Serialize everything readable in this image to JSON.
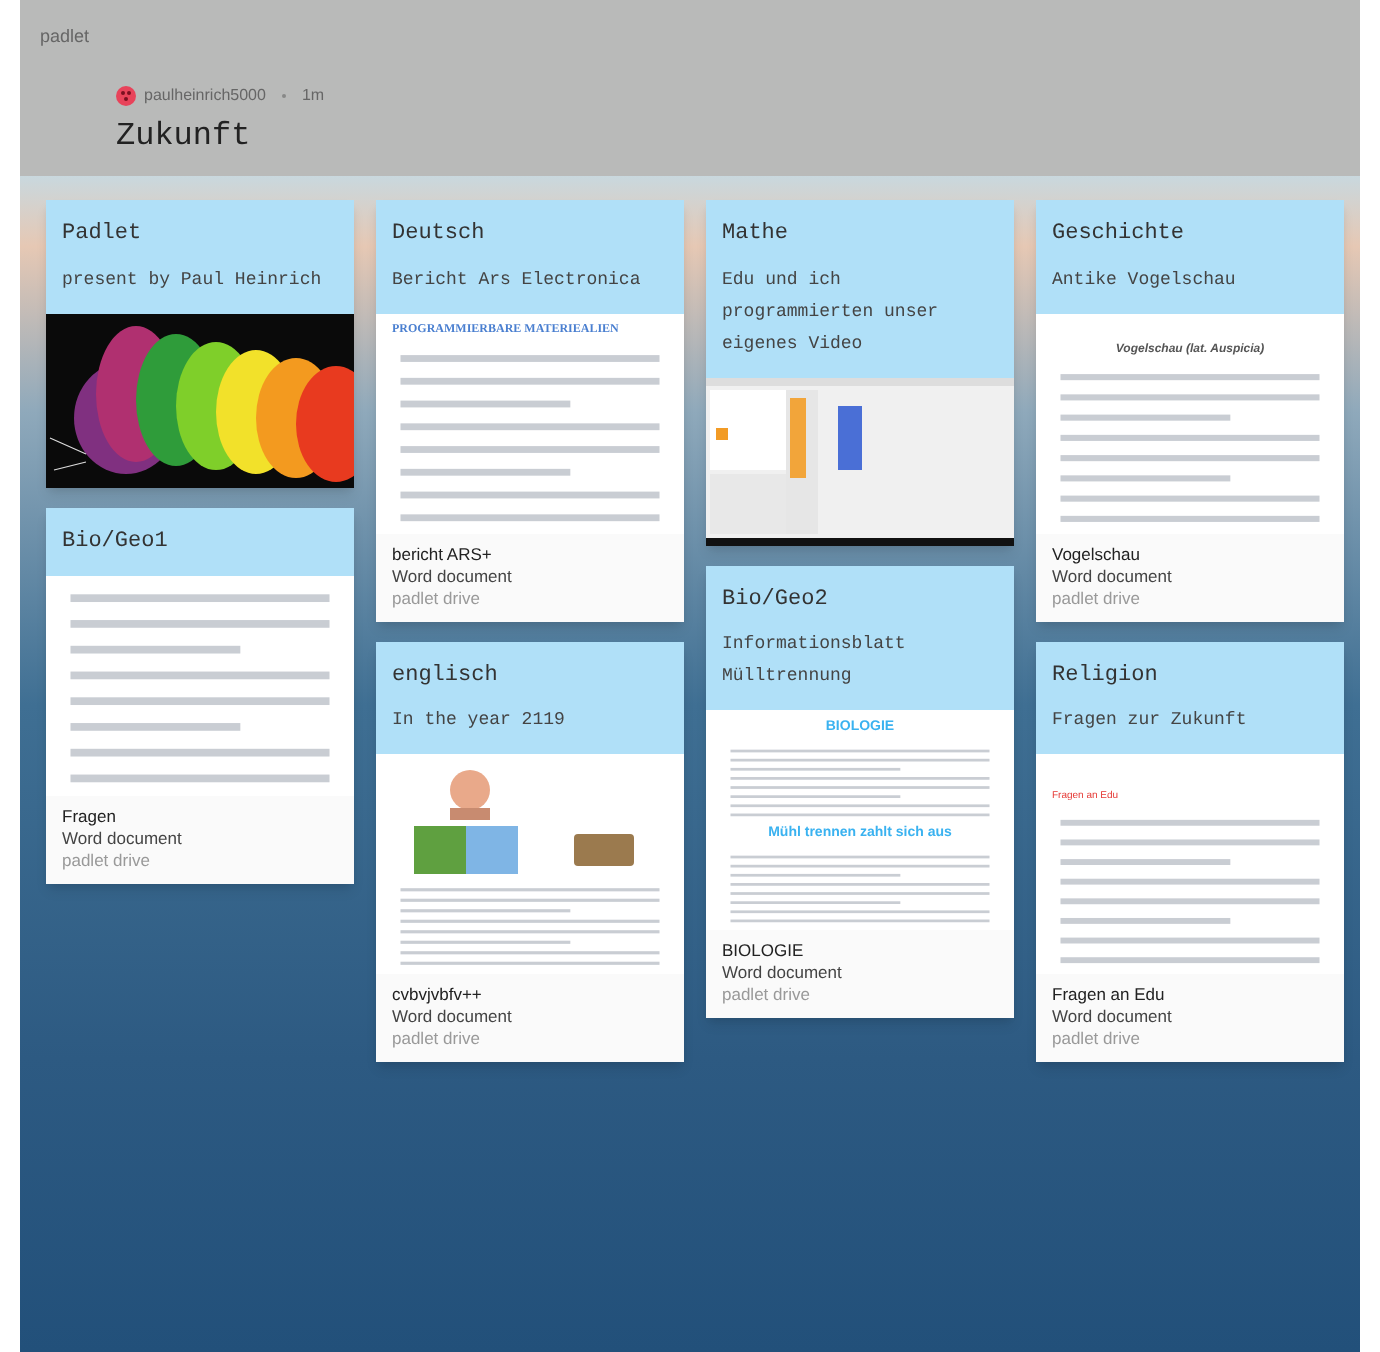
{
  "app_name": "padlet",
  "author": {
    "name": "paulheinrich5000",
    "time": "1m"
  },
  "title": "Zukunft",
  "columns": [
    {
      "posts": [
        {
          "title": "Padlet",
          "subtitle": "present by Paul Heinrich"
        },
        {
          "title": "Bio/Geo1",
          "attachment": {
            "kind": "document",
            "blocks": [
              {
                "kind": "lines"
              }
            ],
            "name": "Fragen",
            "type": "Word document",
            "source": "padlet drive"
          }
        }
      ]
    },
    {
      "posts": [
        {
          "title": "Deutsch",
          "subtitle": "Bericht Ars Electronica",
          "attachment": {
            "kind": "document",
            "blocks": [
              {
                "kind": "serif",
                "text": "PROGRAMMIERBARE MATERIEALIEN"
              },
              {
                "kind": "lines"
              }
            ],
            "name": "bericht ARS+",
            "type": "Word document",
            "source": "padlet drive"
          }
        },
        {
          "title": "englisch",
          "subtitle": "In the year 2119",
          "attachment": {
            "kind": "document",
            "blocks": [
              {
                "kind": "images"
              },
              {
                "kind": "lines"
              }
            ],
            "name": "cvbvjvbfv++",
            "type": "Word document",
            "source": "padlet drive"
          }
        }
      ]
    },
    {
      "posts": [
        {
          "title": "Mathe",
          "subtitle": "Edu und ich programmierten unser eigenes Video",
          "attachment": {
            "kind": "screenshot"
          }
        },
        {
          "title": "Bio/Geo2",
          "subtitle": "Informationsblatt Mülltrennung",
          "attachment": {
            "kind": "document",
            "blocks": [
              {
                "kind": "banner",
                "text": "BIOLOGIE"
              },
              {
                "kind": "lines"
              },
              {
                "kind": "banner",
                "text": "Mühl trennen zahlt sich aus"
              },
              {
                "kind": "lines"
              }
            ],
            "name": "BIOLOGIE",
            "type": "Word document",
            "source": "padlet drive"
          }
        }
      ]
    },
    {
      "posts": [
        {
          "title": "Geschichte",
          "subtitle": "Antike Vogelschau",
          "attachment": {
            "kind": "document",
            "blocks": [
              {
                "kind": "italic",
                "text": "Vogelschau (lat. Auspicia)"
              },
              {
                "kind": "lines"
              }
            ],
            "name": "Vogelschau",
            "type": "Word document",
            "source": "padlet drive"
          }
        },
        {
          "title": "Religion",
          "subtitle": "Fragen zur Zukunft",
          "attachment": {
            "kind": "document",
            "blocks": [
              {
                "kind": "red",
                "text": "Fragen an Edu"
              },
              {
                "kind": "lines"
              }
            ],
            "name": "Fragen an Edu",
            "type": "Word document",
            "source": "padlet drive"
          }
        }
      ]
    }
  ]
}
